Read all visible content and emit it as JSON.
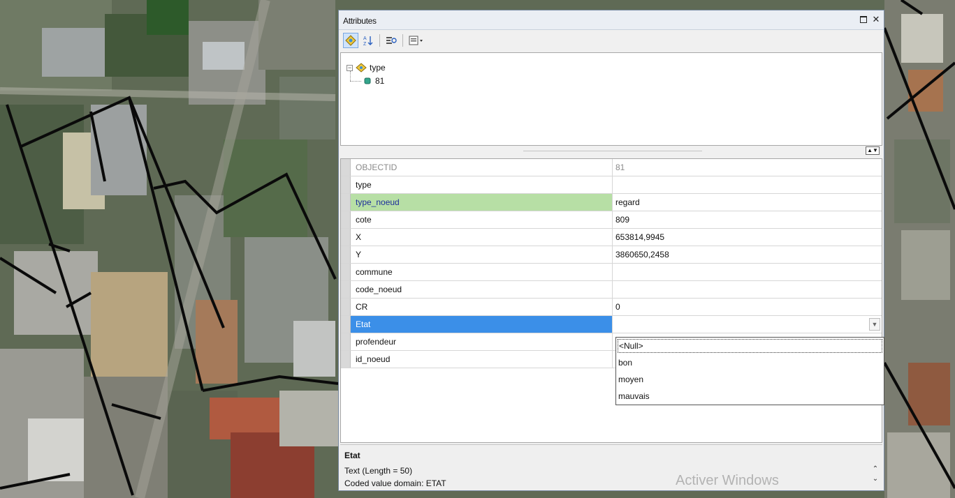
{
  "window": {
    "title": "Attributes"
  },
  "toolbar": {
    "buttons": [
      {
        "name": "list-by-layer",
        "icon": "layers-icon"
      },
      {
        "name": "sort",
        "icon": "sort-icon"
      },
      {
        "name": "identify",
        "icon": "identify-icon"
      },
      {
        "name": "options",
        "icon": "options-icon"
      }
    ]
  },
  "tree": {
    "layer_label": "type",
    "feature_label": "81"
  },
  "fields": [
    {
      "name": "OBJECTID",
      "value": "81",
      "state": "readonly"
    },
    {
      "name": "type",
      "value": "",
      "state": "normal"
    },
    {
      "name": "type_noeud",
      "value": "regard",
      "state": "highlight"
    },
    {
      "name": "cote",
      "value": "809",
      "state": "normal"
    },
    {
      "name": "X",
      "value": "653814,9945",
      "state": "normal"
    },
    {
      "name": "Y",
      "value": "3860650,2458",
      "state": "normal"
    },
    {
      "name": "commune",
      "value": "",
      "state": "normal"
    },
    {
      "name": "code_noeud",
      "value": "",
      "state": "normal"
    },
    {
      "name": "CR",
      "value": "0",
      "state": "normal"
    },
    {
      "name": "Etat",
      "value": "",
      "state": "selected"
    },
    {
      "name": "profendeur",
      "value": "",
      "state": "normal"
    },
    {
      "name": "id_noeud",
      "value": "",
      "state": "normal"
    }
  ],
  "dropdown": {
    "options": [
      "<Null>",
      "bon",
      "moyen",
      "mauvais"
    ],
    "highlighted_index": 0
  },
  "description": {
    "title": "Etat",
    "line1": "Text (Length = 50)",
    "line2": "Coded value domain: ETAT"
  },
  "watermark": "Activer Windows",
  "colors": {
    "selected_row": "#3b8fe8",
    "highlight_row": "#b7dfa5"
  }
}
